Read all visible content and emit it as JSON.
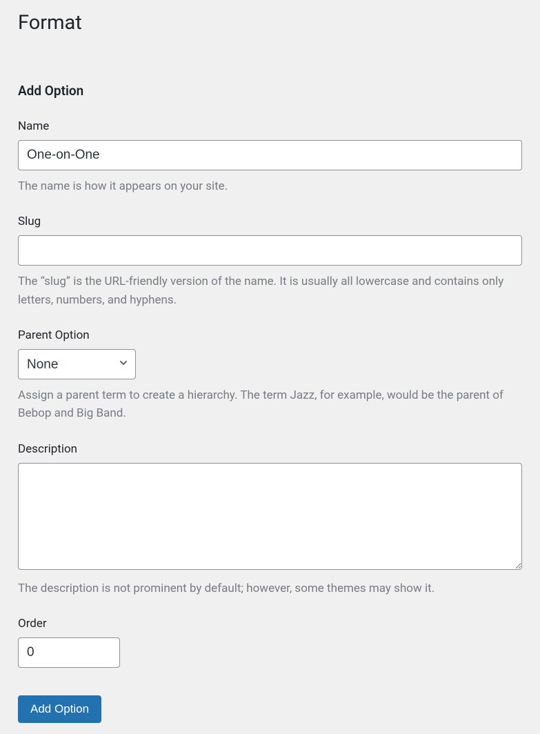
{
  "page": {
    "title": "Format"
  },
  "form": {
    "heading": "Add Option",
    "name": {
      "label": "Name",
      "value": "One-on-One",
      "help": "The name is how it appears on your site."
    },
    "slug": {
      "label": "Slug",
      "value": "",
      "help": "The “slug” is the URL-friendly version of the name. It is usually all lowercase and contains only letters, numbers, and hyphens."
    },
    "parent": {
      "label": "Parent Option",
      "selected": "None",
      "help": "Assign a parent term to create a hierarchy. The term Jazz, for example, would be the parent of Bebop and Big Band."
    },
    "description": {
      "label": "Description",
      "value": "",
      "help": "The description is not prominent by default; however, some themes may show it."
    },
    "order": {
      "label": "Order",
      "value": "0"
    },
    "submit": {
      "label": "Add Option"
    }
  }
}
